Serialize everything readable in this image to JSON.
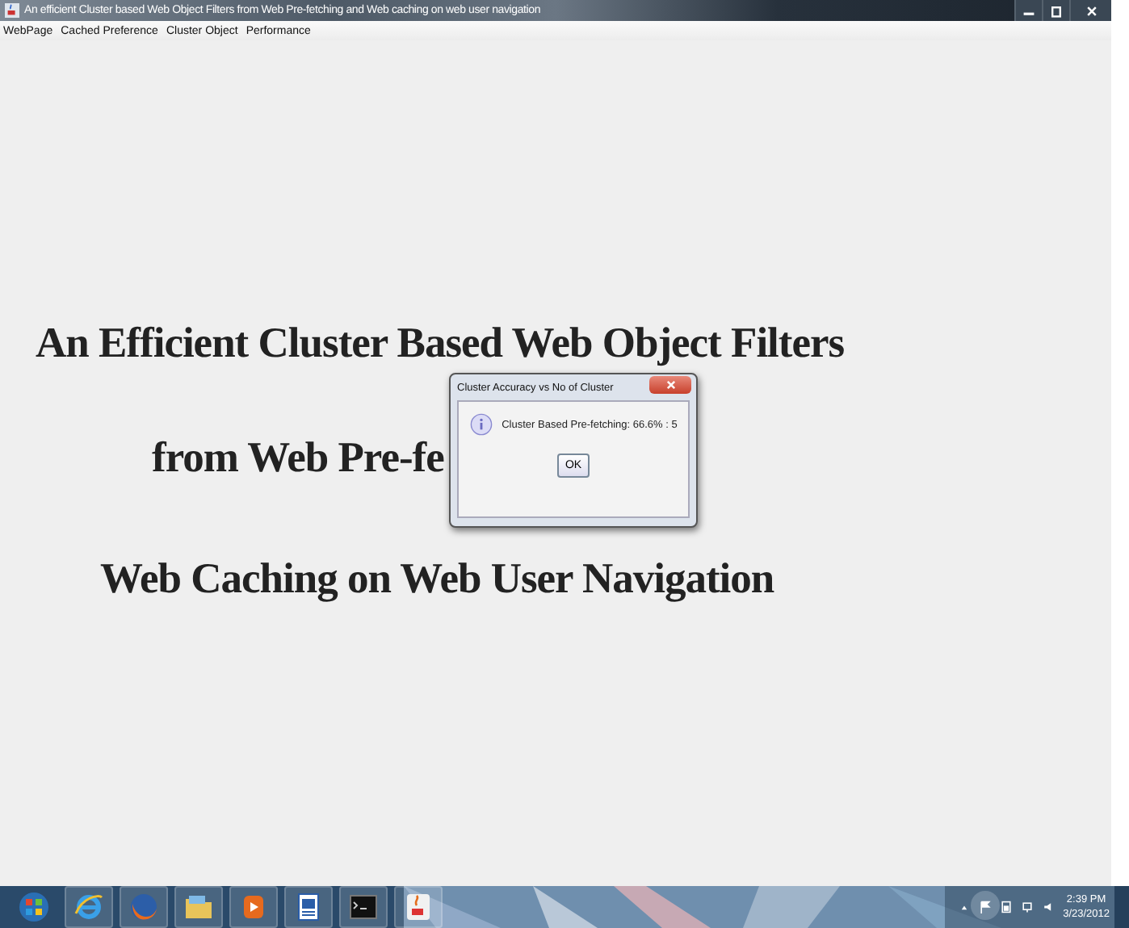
{
  "window": {
    "title": "An efficient Cluster based Web Object Filters from Web Pre-fetching and Web caching on web user navigation"
  },
  "menu": [
    "WebPage",
    "Cached Preference",
    "Cluster Object",
    "Performance"
  ],
  "heading_lines": [
    "An Efficient Cluster Based Web Object Filters",
    "from Web Pre-fe",
    "Web Caching on Web User Navigation"
  ],
  "dialog": {
    "title": "Cluster Accuracy vs No of Cluster",
    "message": "Cluster Based Pre-fetching: 66.6% : 5",
    "buttons": [
      "OK"
    ]
  },
  "taskbar": {
    "apps": [
      {
        "kind": "start"
      },
      {
        "kind": "ie"
      },
      {
        "kind": "firefox"
      },
      {
        "kind": "folder"
      },
      {
        "kind": "media"
      },
      {
        "kind": "word"
      },
      {
        "kind": "terminal"
      },
      {
        "kind": "java"
      }
    ],
    "time": "2:39 PM",
    "date": "3/23/2012"
  }
}
